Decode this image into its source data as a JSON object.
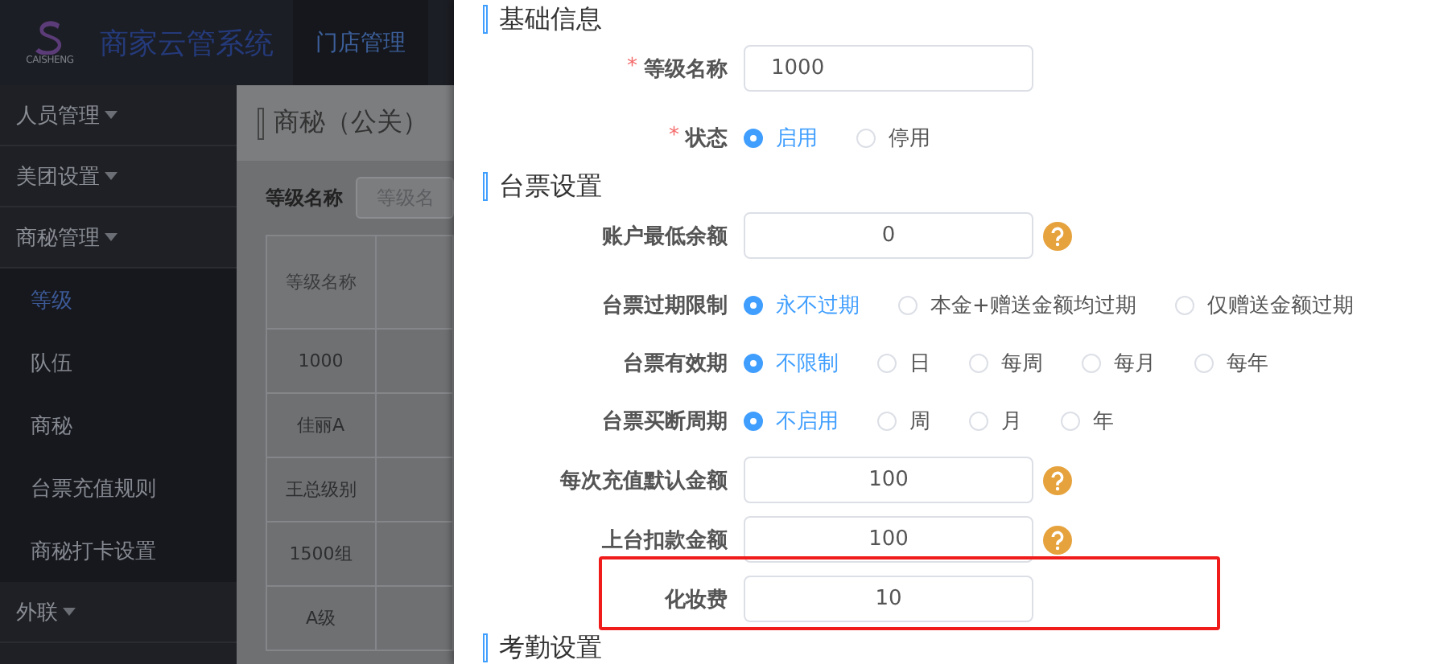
{
  "topbar": {
    "logo_text": "CAISHENG",
    "title": "商家云管系统",
    "nav": [
      {
        "label": "门店管理",
        "selected": true
      }
    ]
  },
  "sidebar": {
    "items": [
      {
        "label": "人员管理"
      },
      {
        "label": "美团设置"
      },
      {
        "label": "商秘管理",
        "children": [
          {
            "label": "等级",
            "selected": true
          },
          {
            "label": "队伍",
            "selected": false
          },
          {
            "label": "商秘",
            "selected": false
          },
          {
            "label": "台票充值规则",
            "selected": false
          },
          {
            "label": "商秘打卡设置",
            "selected": false
          }
        ]
      },
      {
        "label": "外联"
      }
    ]
  },
  "main": {
    "page_title": "商秘（公关）",
    "filter": {
      "label": "等级名称",
      "placeholder": "等级名"
    },
    "table": {
      "columns": [
        "等级名称"
      ],
      "rows": [
        [
          "1000"
        ],
        [
          "佳丽A"
        ],
        [
          "王总级别"
        ],
        [
          "1500组"
        ],
        [
          "A级"
        ]
      ]
    }
  },
  "drawer": {
    "sections": [
      {
        "title": "基础信息",
        "fields": [
          {
            "kind": "text",
            "required_mark": "*",
            "label": "等级名称",
            "value": "1000",
            "help": false,
            "highlighted": false
          },
          {
            "kind": "radio",
            "required_mark": "*",
            "label": "状态",
            "options": [
              {
                "label": "启用",
                "selected": true
              },
              {
                "label": "停用",
                "selected": false
              }
            ]
          }
        ]
      },
      {
        "title": "台票设置",
        "fields": [
          {
            "kind": "number",
            "label": "账户最低余额",
            "value": "0",
            "help": true,
            "highlighted": false
          },
          {
            "kind": "radio",
            "label": "台票过期限制",
            "options": [
              {
                "label": "永不过期",
                "selected": true
              },
              {
                "label": "本金+赠送金额均过期",
                "selected": false
              },
              {
                "label": "仅赠送金额过期",
                "selected": false
              }
            ]
          },
          {
            "kind": "radio",
            "label": "台票有效期",
            "options": [
              {
                "label": "不限制",
                "selected": true
              },
              {
                "label": "日",
                "selected": false
              },
              {
                "label": "每周",
                "selected": false
              },
              {
                "label": "每月",
                "selected": false
              },
              {
                "label": "每年",
                "selected": false
              }
            ]
          },
          {
            "kind": "radio",
            "label": "台票买断周期",
            "options": [
              {
                "label": "不启用",
                "selected": true
              },
              {
                "label": "周",
                "selected": false
              },
              {
                "label": "月",
                "selected": false
              },
              {
                "label": "年",
                "selected": false
              }
            ]
          },
          {
            "kind": "number",
            "label": "每次充值默认金额",
            "value": "100",
            "help": true,
            "highlighted": false
          },
          {
            "kind": "number",
            "label": "上台扣款金额",
            "value": "100",
            "help": true,
            "highlighted": false
          },
          {
            "kind": "number",
            "label": "化妆费",
            "value": "10",
            "help": false,
            "highlighted": true
          }
        ]
      },
      {
        "title": "考勤设置"
      }
    ]
  }
}
